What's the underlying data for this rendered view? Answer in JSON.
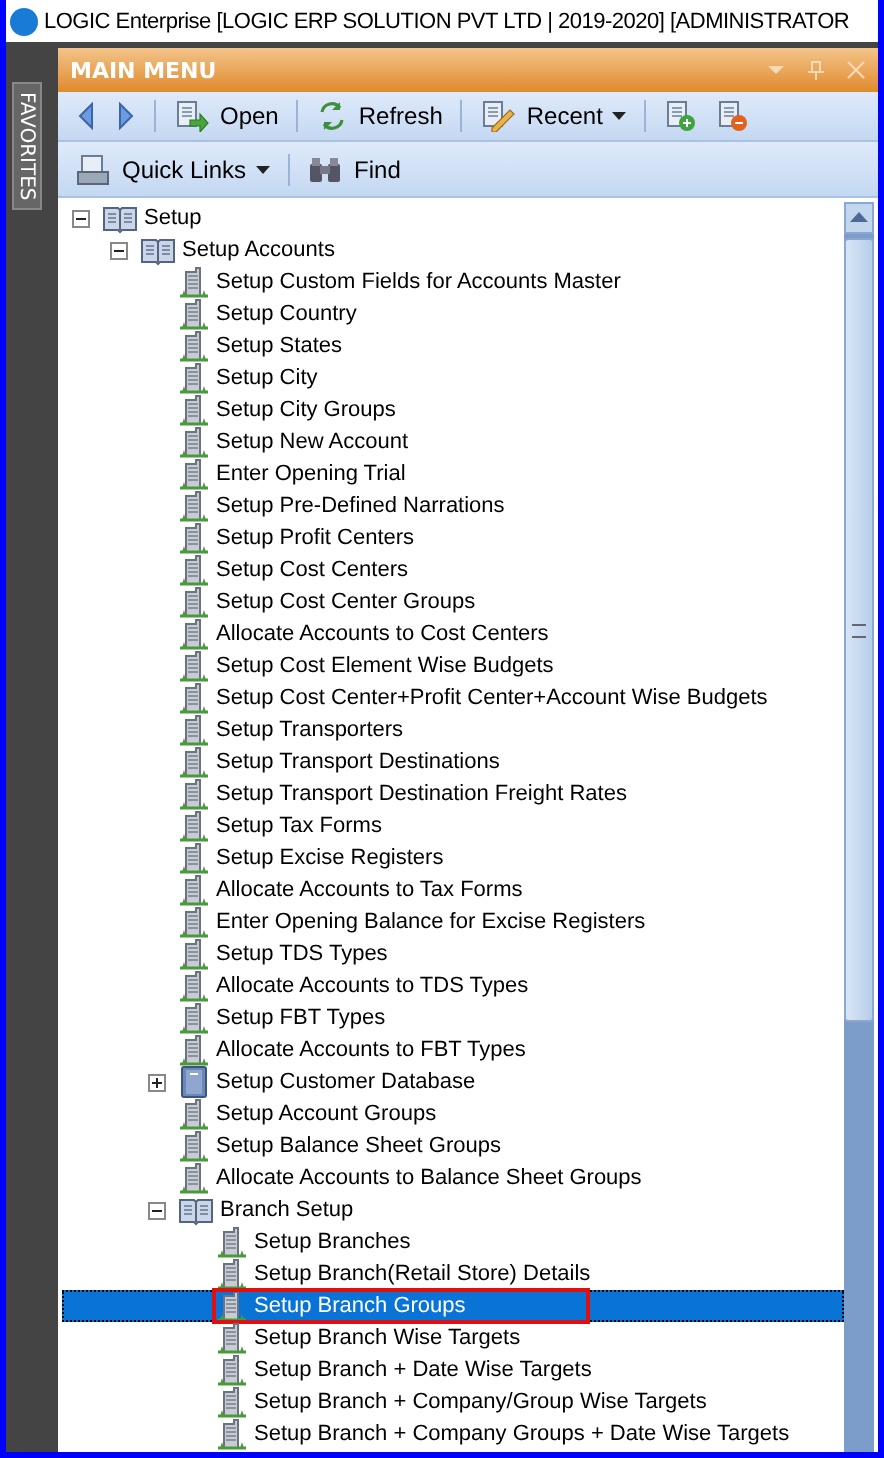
{
  "window": {
    "title": "LOGIC Enterprise [LOGIC ERP SOLUTION PVT LTD | 2019-2020] [ADMINISTRATOR"
  },
  "side_tab": {
    "label": "FAVORITES"
  },
  "panel": {
    "title": "MAIN MENU"
  },
  "toolbar": [
    {
      "kind": "back"
    },
    {
      "kind": "forward"
    },
    {
      "kind": "sep"
    },
    {
      "kind": "open",
      "label": "Open"
    },
    {
      "kind": "sep"
    },
    {
      "kind": "refresh",
      "label": "Refresh"
    },
    {
      "kind": "sep"
    },
    {
      "kind": "recent",
      "label": "Recent",
      "dropdown": true
    },
    {
      "kind": "sep"
    },
    {
      "kind": "add"
    },
    {
      "kind": "remove"
    }
  ],
  "toolbar2": [
    {
      "kind": "links",
      "label": "Quick Links",
      "dropdown": true
    },
    {
      "kind": "sep"
    },
    {
      "kind": "find",
      "label": "Find"
    }
  ],
  "tree": [
    {
      "label": "Setup",
      "kind": "book",
      "expanded": true,
      "selected": false,
      "children": [
        {
          "label": "Setup Accounts",
          "kind": "book",
          "expanded": true,
          "selected": false,
          "children": [
            {
              "label": "Setup Custom Fields for Accounts Master",
              "kind": "leaf",
              "selected": false
            },
            {
              "label": "Setup Country",
              "kind": "leaf",
              "selected": false
            },
            {
              "label": "Setup States",
              "kind": "leaf",
              "selected": false
            },
            {
              "label": "Setup City",
              "kind": "leaf",
              "selected": false
            },
            {
              "label": "Setup City Groups",
              "kind": "leaf",
              "selected": false
            },
            {
              "label": "Setup New Account",
              "kind": "leaf",
              "selected": false
            },
            {
              "label": "Enter Opening Trial",
              "kind": "leaf",
              "selected": false
            },
            {
              "label": "Setup Pre-Defined Narrations",
              "kind": "leaf",
              "selected": false
            },
            {
              "label": "Setup Profit Centers",
              "kind": "leaf",
              "selected": false
            },
            {
              "label": "Setup Cost Centers",
              "kind": "leaf",
              "selected": false
            },
            {
              "label": "Setup Cost Center Groups",
              "kind": "leaf",
              "selected": false
            },
            {
              "label": "Allocate Accounts to Cost Centers",
              "kind": "leaf",
              "selected": false
            },
            {
              "label": "Setup Cost Element Wise Budgets",
              "kind": "leaf",
              "selected": false
            },
            {
              "label": "Setup Cost Center+Profit Center+Account Wise Budgets",
              "kind": "leaf",
              "selected": false
            },
            {
              "label": "Setup Transporters",
              "kind": "leaf",
              "selected": false
            },
            {
              "label": "Setup Transport Destinations",
              "kind": "leaf",
              "selected": false
            },
            {
              "label": "Setup Transport Destination Freight Rates",
              "kind": "leaf",
              "selected": false
            },
            {
              "label": "Setup Tax Forms",
              "kind": "leaf",
              "selected": false
            },
            {
              "label": "Setup Excise Registers",
              "kind": "leaf",
              "selected": false
            },
            {
              "label": "Allocate Accounts to Tax Forms",
              "kind": "leaf",
              "selected": false
            },
            {
              "label": "Enter Opening Balance for Excise Registers",
              "kind": "leaf",
              "selected": false
            },
            {
              "label": "Setup TDS Types",
              "kind": "leaf",
              "selected": false
            },
            {
              "label": "Allocate Accounts to TDS Types",
              "kind": "leaf",
              "selected": false
            },
            {
              "label": "Setup FBT Types",
              "kind": "leaf",
              "selected": false
            },
            {
              "label": "Allocate Accounts to FBT Types",
              "kind": "leaf",
              "selected": false
            },
            {
              "label": "Setup Customer Database",
              "kind": "database",
              "expanded": false,
              "selected": false
            },
            {
              "label": "Setup Account Groups",
              "kind": "leaf",
              "selected": false
            },
            {
              "label": "Setup Balance Sheet Groups",
              "kind": "leaf",
              "selected": false
            },
            {
              "label": "Allocate Accounts to Balance Sheet Groups",
              "kind": "leaf",
              "selected": false
            },
            {
              "label": "Branch Setup",
              "kind": "book",
              "expanded": true,
              "selected": false,
              "children": [
                {
                  "label": "Setup Branches",
                  "kind": "leaf",
                  "selected": false
                },
                {
                  "label": "Setup Branch(Retail Store) Details",
                  "kind": "leaf",
                  "selected": false
                },
                {
                  "label": "Setup Branch Groups",
                  "kind": "leaf",
                  "selected": true,
                  "outlined": true
                },
                {
                  "label": "Setup Branch Wise Targets",
                  "kind": "leaf",
                  "selected": false
                },
                {
                  "label": "Setup Branch + Date Wise Targets",
                  "kind": "leaf",
                  "selected": false
                },
                {
                  "label": "Setup Branch + Company/Group Wise Targets",
                  "kind": "leaf",
                  "selected": false
                },
                {
                  "label": "Setup Branch + Company Groups + Date Wise Targets",
                  "kind": "leaf",
                  "selected": false
                }
              ]
            }
          ]
        }
      ]
    }
  ]
}
